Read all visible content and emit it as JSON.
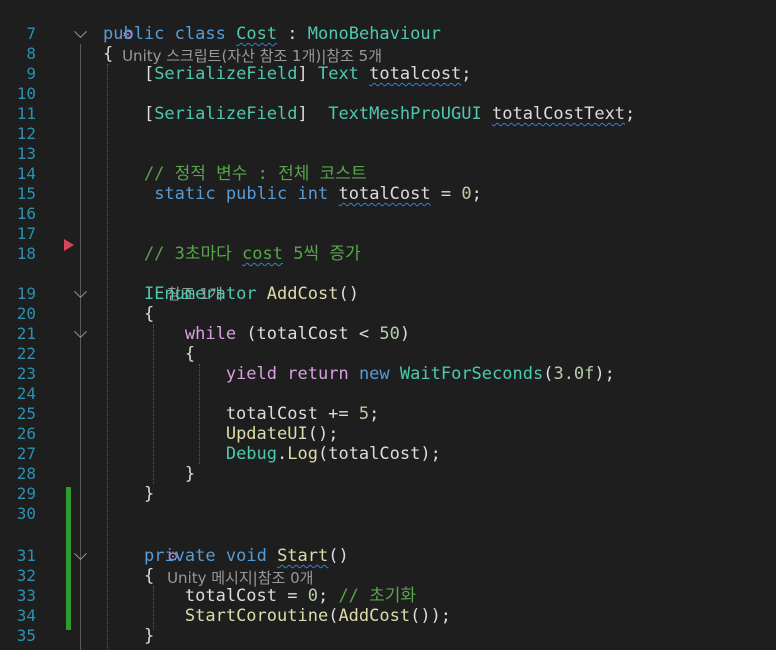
{
  "codelens": {
    "class_refs": "Unity 스크립트(자산 참조 1개)|참조 5개",
    "method_refs": "참조 1개",
    "start_refs": "Unity 메시지|참조 0개"
  },
  "lines": [
    {
      "num": "7",
      "segments": [
        {
          "t": "public",
          "c": "kw"
        },
        {
          "t": " ",
          "c": "pl"
        },
        {
          "t": "class",
          "c": "kw"
        },
        {
          "t": " ",
          "c": "pl"
        },
        {
          "t": "Cost",
          "c": "ty",
          "sq": true
        },
        {
          "t": " : ",
          "c": "pl"
        },
        {
          "t": "MonoBehaviour",
          "c": "ty"
        }
      ]
    },
    {
      "num": "8",
      "segments": [
        {
          "t": "{",
          "c": "pl"
        }
      ]
    },
    {
      "num": "9",
      "segments": [
        {
          "t": "    [",
          "c": "pl"
        },
        {
          "t": "SerializeField",
          "c": "ty"
        },
        {
          "t": "] ",
          "c": "pl"
        },
        {
          "t": "Text",
          "c": "ty"
        },
        {
          "t": " ",
          "c": "pl"
        },
        {
          "t": "totalcost",
          "c": "pl",
          "sq": true
        },
        {
          "t": ";",
          "c": "pl"
        }
      ]
    },
    {
      "num": "10",
      "segments": []
    },
    {
      "num": "11",
      "segments": [
        {
          "t": "    [",
          "c": "pl"
        },
        {
          "t": "SerializeField",
          "c": "ty"
        },
        {
          "t": "]  ",
          "c": "pl"
        },
        {
          "t": "TextMeshProUGUI",
          "c": "ty"
        },
        {
          "t": " ",
          "c": "pl"
        },
        {
          "t": "totalCostText",
          "c": "pl",
          "sq": true
        },
        {
          "t": ";",
          "c": "pl"
        }
      ]
    },
    {
      "num": "12",
      "segments": []
    },
    {
      "num": "13",
      "segments": []
    },
    {
      "num": "14",
      "segments": [
        {
          "t": "    // 정적 변수 : 전체 코스트",
          "c": "cm"
        }
      ]
    },
    {
      "num": "15",
      "segments": [
        {
          "t": "     ",
          "c": "pl"
        },
        {
          "t": "static",
          "c": "kw"
        },
        {
          "t": " ",
          "c": "pl"
        },
        {
          "t": "public",
          "c": "kw"
        },
        {
          "t": " ",
          "c": "pl"
        },
        {
          "t": "int",
          "c": "kw"
        },
        {
          "t": " ",
          "c": "pl"
        },
        {
          "t": "totalCost",
          "c": "pl",
          "sq": true
        },
        {
          "t": " = ",
          "c": "pl"
        },
        {
          "t": "0",
          "c": "num"
        },
        {
          "t": ";",
          "c": "pl"
        }
      ]
    },
    {
      "num": "16",
      "segments": []
    },
    {
      "num": "17",
      "segments": []
    },
    {
      "num": "18",
      "segments": [
        {
          "t": "    // 3초마다 ",
          "c": "cm"
        },
        {
          "t": "cost",
          "c": "cm",
          "sq": true
        },
        {
          "t": " 5씩 증가",
          "c": "cm"
        }
      ]
    },
    {
      "num": "19",
      "segments": [
        {
          "t": "    ",
          "c": "pl"
        },
        {
          "t": "IEnumerator",
          "c": "ty"
        },
        {
          "t": " ",
          "c": "pl"
        },
        {
          "t": "AddCost",
          "c": "mt"
        },
        {
          "t": "()",
          "c": "pl"
        }
      ]
    },
    {
      "num": "20",
      "segments": [
        {
          "t": "    {",
          "c": "pl"
        }
      ]
    },
    {
      "num": "21",
      "segments": [
        {
          "t": "        ",
          "c": "pl"
        },
        {
          "t": "while",
          "c": "kwc"
        },
        {
          "t": " (totalCost < ",
          "c": "pl"
        },
        {
          "t": "50",
          "c": "num"
        },
        {
          "t": ")",
          "c": "pl"
        }
      ]
    },
    {
      "num": "22",
      "segments": [
        {
          "t": "        {",
          "c": "pl"
        }
      ]
    },
    {
      "num": "23",
      "segments": [
        {
          "t": "            ",
          "c": "pl"
        },
        {
          "t": "yield",
          "c": "kwc"
        },
        {
          "t": " ",
          "c": "pl"
        },
        {
          "t": "return",
          "c": "kwc"
        },
        {
          "t": " ",
          "c": "pl"
        },
        {
          "t": "new",
          "c": "kw"
        },
        {
          "t": " ",
          "c": "pl"
        },
        {
          "t": "WaitForSeconds",
          "c": "ty"
        },
        {
          "t": "(",
          "c": "pl"
        },
        {
          "t": "3.0f",
          "c": "num"
        },
        {
          "t": ");",
          "c": "pl"
        }
      ]
    },
    {
      "num": "24",
      "segments": []
    },
    {
      "num": "25",
      "segments": [
        {
          "t": "            totalCost += ",
          "c": "pl"
        },
        {
          "t": "5",
          "c": "num"
        },
        {
          "t": ";",
          "c": "pl"
        }
      ]
    },
    {
      "num": "26",
      "segments": [
        {
          "t": "            ",
          "c": "pl"
        },
        {
          "t": "UpdateUI",
          "c": "mt"
        },
        {
          "t": "();",
          "c": "pl"
        }
      ]
    },
    {
      "num": "27",
      "segments": [
        {
          "t": "            ",
          "c": "pl"
        },
        {
          "t": "Debug",
          "c": "ty"
        },
        {
          "t": ".",
          "c": "pl"
        },
        {
          "t": "Log",
          "c": "mt"
        },
        {
          "t": "(totalCost);",
          "c": "pl"
        }
      ]
    },
    {
      "num": "28",
      "segments": [
        {
          "t": "        }",
          "c": "pl"
        }
      ]
    },
    {
      "num": "29",
      "segments": [
        {
          "t": "    }",
          "c": "pl"
        }
      ]
    },
    {
      "num": "30",
      "segments": []
    },
    {
      "num": "31",
      "segments": [
        {
          "t": "    ",
          "c": "pl"
        },
        {
          "t": "private",
          "c": "kw"
        },
        {
          "t": " ",
          "c": "pl"
        },
        {
          "t": "void",
          "c": "kw"
        },
        {
          "t": " ",
          "c": "pl"
        },
        {
          "t": "Start",
          "c": "mt",
          "sq": true
        },
        {
          "t": "()",
          "c": "pl"
        }
      ]
    },
    {
      "num": "32",
      "segments": [
        {
          "t": "    {",
          "c": "pl"
        }
      ]
    },
    {
      "num": "33",
      "segments": [
        {
          "t": "        totalCost = ",
          "c": "pl"
        },
        {
          "t": "0",
          "c": "num"
        },
        {
          "t": "; ",
          "c": "pl"
        },
        {
          "t": "// 초기화",
          "c": "cm"
        }
      ]
    },
    {
      "num": "34",
      "segments": [
        {
          "t": "        ",
          "c": "pl"
        },
        {
          "t": "StartCoroutine",
          "c": "mt"
        },
        {
          "t": "(",
          "c": "pl"
        },
        {
          "t": "AddCost",
          "c": "mt"
        },
        {
          "t": "());",
          "c": "pl"
        }
      ]
    },
    {
      "num": "35",
      "segments": [
        {
          "t": "    }",
          "c": "pl"
        }
      ]
    }
  ],
  "icons": {
    "codelens_icon": "unity-script-icon",
    "fold": "chevron-down-icon",
    "breakpoint": "bookmark-arrow-icon"
  },
  "colors": {
    "background": "#1e1e1e",
    "line_number": "#2b91af",
    "keyword": "#569cd6",
    "control_keyword": "#d8a0df",
    "type": "#4ec9b0",
    "method": "#dcdcaa",
    "number": "#b5cea8",
    "comment": "#57a64a",
    "change_bar": "#2e9b2e"
  }
}
